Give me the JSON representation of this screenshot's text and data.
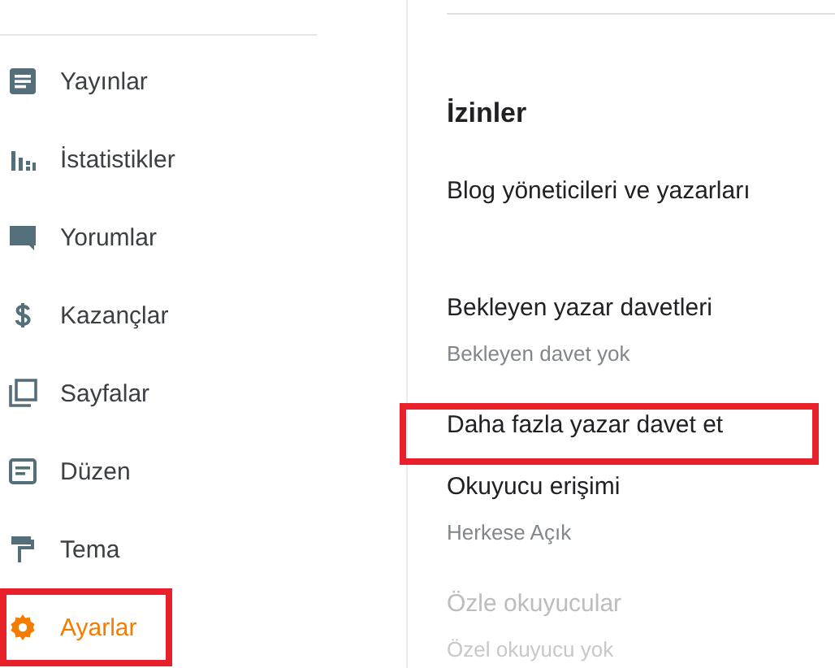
{
  "sidebar": {
    "items": [
      {
        "label": "Yayınlar",
        "selected": false,
        "highlighted": false
      },
      {
        "label": "İstatistikler",
        "selected": false,
        "highlighted": false
      },
      {
        "label": "Yorumlar",
        "selected": false,
        "highlighted": false
      },
      {
        "label": "Kazançlar",
        "selected": false,
        "highlighted": false
      },
      {
        "label": "Sayfalar",
        "selected": false,
        "highlighted": false
      },
      {
        "label": "Düzen",
        "selected": false,
        "highlighted": false
      },
      {
        "label": "Tema",
        "selected": false,
        "highlighted": false
      },
      {
        "label": "Ayarlar",
        "selected": true,
        "highlighted": true
      }
    ]
  },
  "section": {
    "title": "İzinler",
    "items": [
      {
        "kind": "setting",
        "title": "Blog yöneticileri ve yazarları",
        "disabled": false,
        "highlighted": false
      },
      {
        "kind": "setting",
        "title": "Bekleyen yazar davetleri",
        "subtitle": "Bekleyen davet yok",
        "disabled": false,
        "highlighted": false
      },
      {
        "kind": "link",
        "title": "Daha fazla yazar davet et",
        "disabled": false,
        "highlighted": true
      },
      {
        "kind": "setting",
        "title": "Okuyucu erişimi",
        "subtitle": "Herkese Açık",
        "disabled": false,
        "highlighted": false
      },
      {
        "kind": "setting",
        "title": "Özle okuyucular",
        "subtitle": "Özel okuyucu yok",
        "disabled": true,
        "highlighted": false
      }
    ]
  }
}
